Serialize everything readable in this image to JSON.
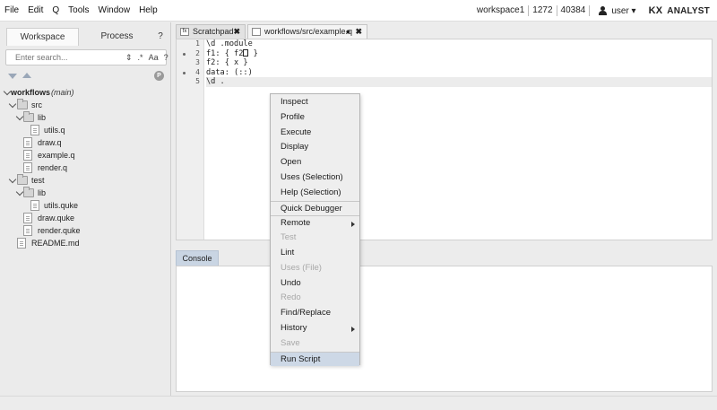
{
  "menubar": {
    "items": [
      "File",
      "Edit",
      "Q",
      "Tools",
      "Window",
      "Help"
    ],
    "workspace": "workspace1",
    "port1": "1272",
    "port2": "40384",
    "user": "user ▾",
    "logo_kx": "KX",
    "logo_text": "ANALYST"
  },
  "left": {
    "tabs": {
      "workspace": "Workspace",
      "process": "Process",
      "help": "?"
    },
    "search": {
      "placeholder": "Enter search...",
      "opt_arrows": "⇕",
      "opt_regex": ".*",
      "opt_case": "Aa",
      "opt_help": "?"
    },
    "p_badge": "P",
    "tree": {
      "root": "workflows",
      "root_note": "(main)",
      "src": "src",
      "src_lib": "lib",
      "utils_q": "utils.q",
      "draw_q": "draw.q",
      "example_q": "example.q",
      "render_q": "render.q",
      "test": "test",
      "test_lib": "lib",
      "utils_quke": "utils.quke",
      "draw_quke": "draw.quke",
      "render_quke": "render.quke",
      "readme": "README.md"
    }
  },
  "editor": {
    "tabs": [
      {
        "icon": "fx",
        "label": "Scratchpad",
        "close": "✖"
      },
      {
        "label": "workflows/src/example.q",
        "modified": "●",
        "close": "✖"
      }
    ],
    "line_numbers": [
      "1",
      "2",
      "3",
      "4",
      "5"
    ],
    "lines": [
      "\\d .module",
      "f1: { f2",
      " }",
      "f2: { x }",
      "data: (::)",
      "\\d ."
    ]
  },
  "console": {
    "tab": "Console"
  },
  "context_menu": {
    "items": [
      {
        "label": "Inspect"
      },
      {
        "label": "Profile"
      },
      {
        "label": "Execute"
      },
      {
        "label": "Display"
      },
      {
        "label": "Open"
      },
      {
        "label": "Uses (Selection)"
      },
      {
        "label": "Help (Selection)"
      },
      {
        "label": "Quick Debugger"
      },
      {
        "label": "Remote"
      },
      {
        "label": "Test"
      },
      {
        "label": "Lint"
      },
      {
        "label": "Uses (File)"
      },
      {
        "label": "Undo"
      },
      {
        "label": "Redo"
      },
      {
        "label": "Find/Replace"
      },
      {
        "label": "History"
      },
      {
        "label": "Save"
      },
      {
        "label": "Run Script"
      }
    ]
  }
}
